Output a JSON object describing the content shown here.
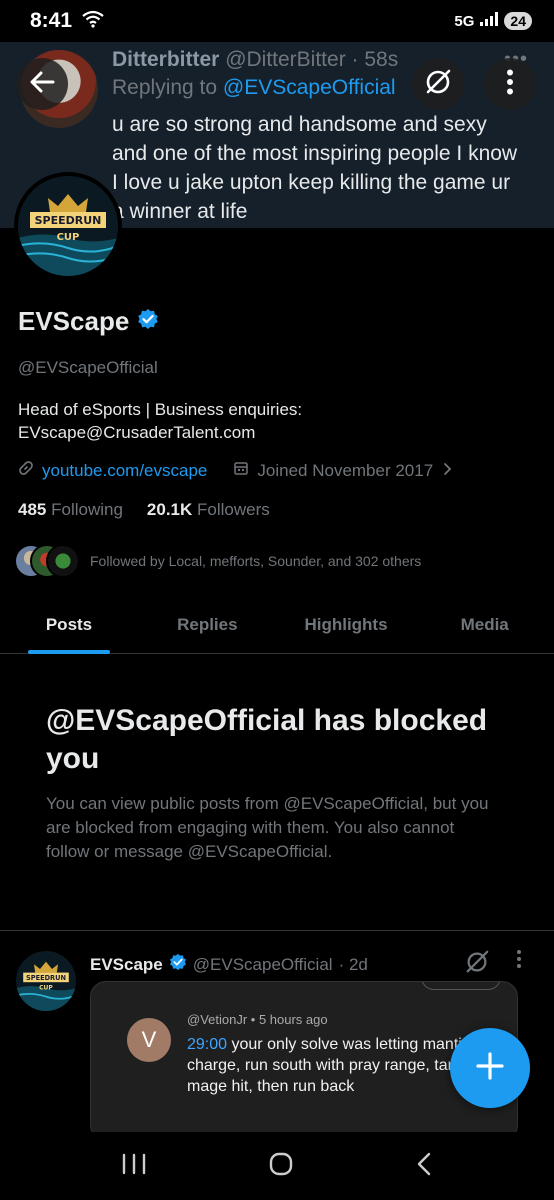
{
  "status_bar": {
    "time": "8:41",
    "network": "5G",
    "battery": "24"
  },
  "banner": {
    "name": "Ditterbitter",
    "handle": "@DitterBitter",
    "time": "· 58s",
    "replying_prefix": "Replying to ",
    "replying_to": "@EVScapeOfficial",
    "text": "u are so strong and handsome and sexy and one of the most inspiring people I know I love u jake upton keep killing the game ur a winner at life"
  },
  "profile": {
    "avatar_text_1": "SPEEDRUN",
    "avatar_text_2": "CUP",
    "display_name": "EVScape",
    "handle": "@EVScapeOfficial",
    "bio": "Head of eSports | Business enquiries: EVscape@CrusaderTalent.com",
    "website": "youtube.com/evscape",
    "joined": "Joined November 2017",
    "following_count": "485",
    "following_label": "Following",
    "followers_count": "20.1K",
    "followers_label": "Followers",
    "followed_by": "Followed by Local, mefforts, Sounder, and 302 others"
  },
  "tabs": [
    {
      "label": "Posts"
    },
    {
      "label": "Replies"
    },
    {
      "label": "Highlights"
    },
    {
      "label": "Media"
    }
  ],
  "blocked": {
    "title": "@EVScapeOfficial has blocked you",
    "text": "You can view public posts from @EVScapeOfficial, but you are blocked from engaging with them. You also cannot follow or message @EVScapeOfficial."
  },
  "post": {
    "name": "EVScape",
    "handle": "@EVScapeOfficial",
    "time": "· 2d",
    "media": {
      "avatar_letter": "V",
      "meta": "@VetionJr • 5 hours ago",
      "timestamp": "29:00",
      "comment": " your only solve was letting manticore charge, run south with pray range, tank the mage hit, then run back"
    }
  },
  "colors": {
    "accent": "#1d9bf0",
    "background": "#000000",
    "muted": "#71767b"
  },
  "icons": [
    "back-arrow-icon",
    "grok-icon",
    "more-vertical-icon",
    "verified-badge-icon",
    "link-icon",
    "calendar-icon",
    "chevron-right-icon",
    "plus-icon",
    "recents-icon",
    "home-icon",
    "back-icon"
  ]
}
